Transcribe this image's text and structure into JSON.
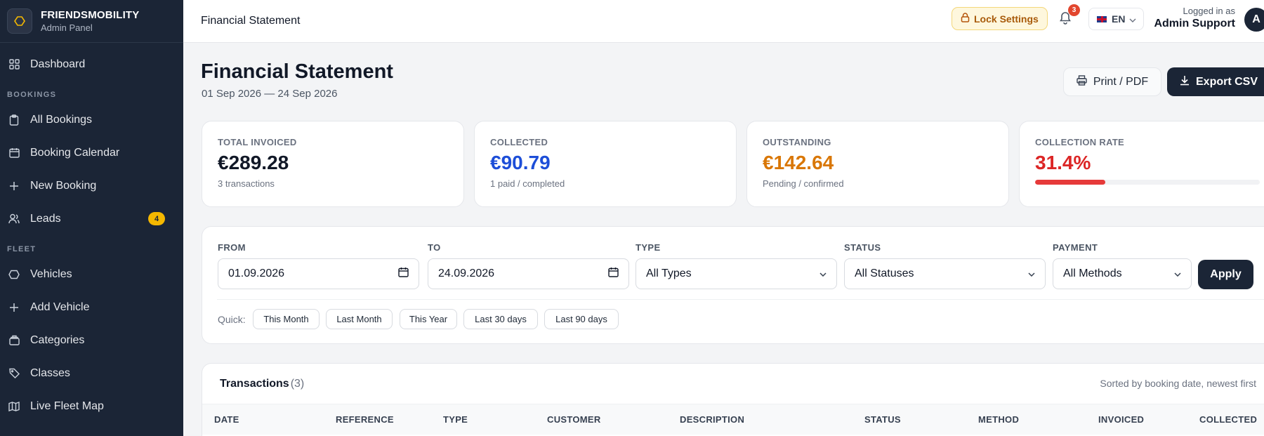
{
  "brand": {
    "name": "FRIENDSMOBILITY",
    "subtitle": "Admin Panel"
  },
  "sidebar": {
    "dashboard": "Dashboard",
    "section_bookings": "BOOKINGS",
    "all_bookings": "All Bookings",
    "booking_calendar": "Booking Calendar",
    "new_booking": "New Booking",
    "leads": "Leads",
    "leads_badge": "4",
    "section_fleet": "FLEET",
    "vehicles": "Vehicles",
    "add_vehicle": "Add Vehicle",
    "categories": "Categories",
    "classes": "Classes",
    "live_fleet_map": "Live Fleet Map"
  },
  "topbar": {
    "title": "Financial Statement",
    "lock_settings": "Lock Settings",
    "notifications_count": "3",
    "language": "EN",
    "logged_in_label": "Logged in as",
    "user_name": "Admin Support",
    "avatar_initial": "A"
  },
  "page": {
    "title": "Financial Statement",
    "date_range": "01 Sep 2026 — 24 Sep 2026",
    "print_label": "Print / PDF",
    "export_label": "Export CSV"
  },
  "stats": {
    "total_invoiced": {
      "label": "TOTAL INVOICED",
      "value": "€289.28",
      "sub": "3 transactions"
    },
    "collected": {
      "label": "COLLECTED",
      "value": "€90.79",
      "sub": "1 paid / completed"
    },
    "outstanding": {
      "label": "OUTSTANDING",
      "value": "€142.64",
      "sub": "Pending / confirmed"
    },
    "collection_rate": {
      "label": "COLLECTION RATE",
      "value": "31.4%",
      "fraction": 0.314
    }
  },
  "colors": {
    "collected": "#1d4ed8",
    "outstanding": "#d97706",
    "rate": "#dc2626",
    "dark": "#1b2536"
  },
  "filters": {
    "from_label": "FROM",
    "from_value": "01.09.2026",
    "to_label": "TO",
    "to_value": "24.09.2026",
    "type_label": "TYPE",
    "type_value": "All Types",
    "status_label": "STATUS",
    "status_value": "All Statuses",
    "payment_label": "PAYMENT",
    "payment_value": "All Methods",
    "apply_label": "Apply",
    "quick_label": "Quick:",
    "quick": [
      "This Month",
      "Last Month",
      "This Year",
      "Last 30 days",
      "Last 90 days"
    ]
  },
  "transactions": {
    "title": "Transactions",
    "count": "(3)",
    "sort_note": "Sorted by booking date, newest first",
    "columns": [
      "DATE",
      "REFERENCE",
      "TYPE",
      "CUSTOMER",
      "DESCRIPTION",
      "STATUS",
      "METHOD",
      "INVOICED",
      "COLLECTED"
    ]
  }
}
